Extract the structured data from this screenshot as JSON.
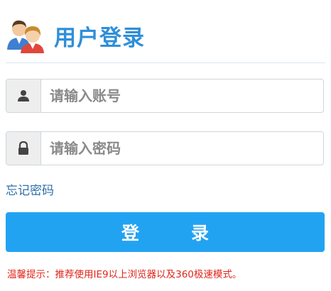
{
  "header": {
    "title": "用户登录",
    "icon": "users-icon"
  },
  "username": {
    "icon": "user-icon",
    "placeholder": "请输入账号",
    "value": ""
  },
  "password": {
    "icon": "lock-icon",
    "placeholder": "请输入密码",
    "value": ""
  },
  "forgot_password": "忘记密码",
  "login_button": "登　录",
  "tip": "温馨提示：推荐使用IE9以上浏览器以及360极速模式。",
  "colors": {
    "title": "#2f8fd8",
    "button": "#22a3f2",
    "tip": "#e0261b",
    "link": "#2f6fa8"
  }
}
